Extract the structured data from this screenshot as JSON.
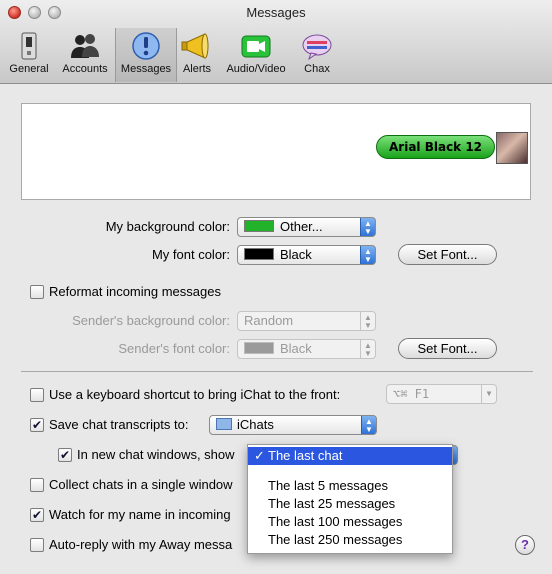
{
  "window": {
    "title": "Messages"
  },
  "toolbar": {
    "items": [
      {
        "label": "General",
        "icon": "switch-icon"
      },
      {
        "label": "Accounts",
        "icon": "people-icon"
      },
      {
        "label": "Messages",
        "icon": "exclamation-icon",
        "selected": true
      },
      {
        "label": "Alerts",
        "icon": "megaphone-icon"
      },
      {
        "label": "Audio/Video",
        "icon": "video-camera-icon"
      },
      {
        "label": "Chax",
        "icon": "chax-icon"
      }
    ]
  },
  "preview": {
    "bubble_text": "Arial Black 12",
    "bubble_color": "#1aa31b"
  },
  "background_color": {
    "label": "My background color:",
    "value": "Other...",
    "swatch": "#22b32a"
  },
  "font_color": {
    "label": "My font color:",
    "value": "Black",
    "swatch": "#000000",
    "button": "Set Font..."
  },
  "reformat": {
    "label": "Reformat incoming messages",
    "checked": false
  },
  "sender_bg": {
    "label": "Sender's background color:",
    "value": "Random"
  },
  "sender_font": {
    "label": "Sender's font color:",
    "value": "Black",
    "button": "Set Font..."
  },
  "shortcut": {
    "label": "Use a keyboard shortcut to bring iChat to the front:",
    "checked": false,
    "value": "⌥⌘ F1"
  },
  "transcripts": {
    "label": "Save chat transcripts to:",
    "checked": true,
    "folder": "iChats"
  },
  "new_windows": {
    "label": "In new chat windows, show",
    "checked": true
  },
  "collect": {
    "label": "Collect chats in a single window",
    "checked": false
  },
  "watch": {
    "label": "Watch for my name in incoming",
    "checked": true
  },
  "auto_reply": {
    "label": "Auto-reply with my Away messa",
    "checked": false
  },
  "menu": {
    "items": [
      "The last chat",
      "The last 5 messages",
      "The last 25 messages",
      "The last 100 messages",
      "The last 250 messages"
    ],
    "selected": "The last chat"
  },
  "help": {
    "label": "?"
  }
}
